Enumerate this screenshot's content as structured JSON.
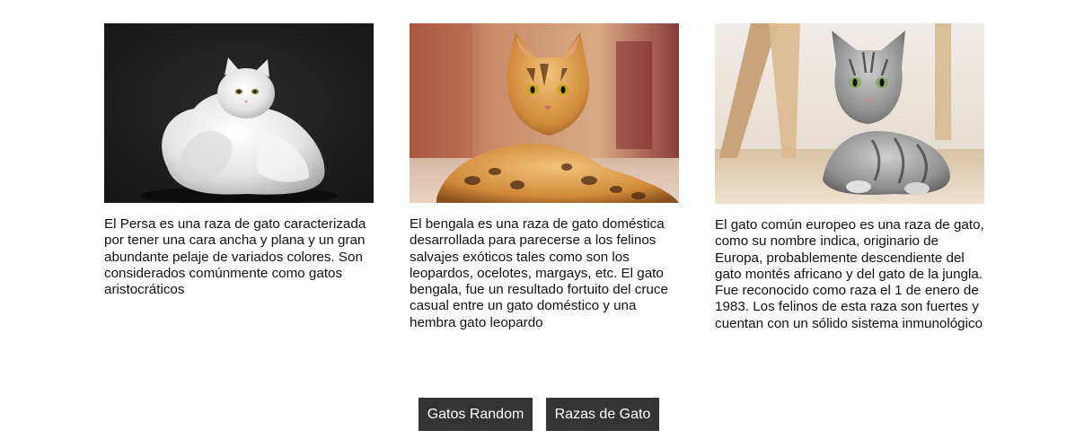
{
  "cards": [
    {
      "image_alt": "persian-cat-photo",
      "description": "El Persa es una raza de gato caracterizada por tener una cara ancha y plana y un gran abundante pelaje de variados colores. Son considerados comúnmente como gatos aristocráticos"
    },
    {
      "image_alt": "bengal-cat-photo",
      "description": "El bengala es una raza de gato doméstica desarrollada para parecerse a los felinos salvajes exóticos tales como son los leopardos, ocelotes, margays, etc. El gato bengala, fue un resultado fortuito del cruce casual entre un gato doméstico y una hembra gato leopardo"
    },
    {
      "image_alt": "european-cat-photo",
      "description": "El gato común europeo es una raza de gato, como su nombre indica, originario de Europa, probablemente descendiente del gato montés africano y del gato de la jungla. Fue reconocido como raza el 1 de enero de 1983. Los felinos de esta raza son fuertes y cuentan con un sólido sistema inmunológico"
    }
  ],
  "nav": {
    "random_label": "Gatos Random",
    "breeds_label": "Razas de Gato"
  },
  "colors": {
    "button_bg": "#343434",
    "button_text": "#ffffff",
    "page_bg": "#ffffff",
    "text": "#111111"
  }
}
